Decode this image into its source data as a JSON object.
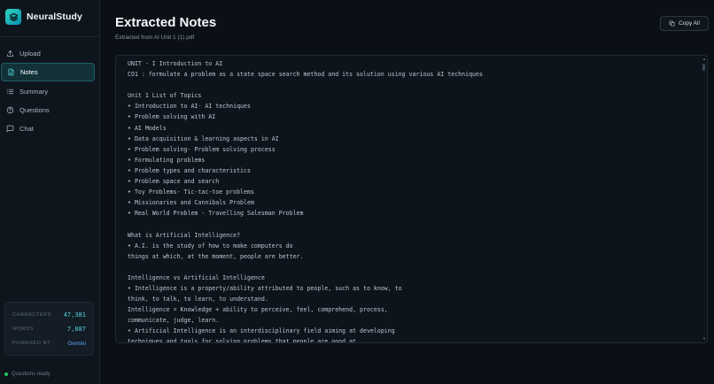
{
  "brand": {
    "name": "NeuralStudy",
    "logo_icon": "layers-icon",
    "accent": "#2dd4bf"
  },
  "nav": [
    {
      "label": "Upload",
      "icon": "upload-icon",
      "active": false
    },
    {
      "label": "Notes",
      "icon": "document-icon",
      "active": true
    },
    {
      "label": "Summary",
      "icon": "list-icon",
      "active": false
    },
    {
      "label": "Questions",
      "icon": "help-circle-icon",
      "active": false
    },
    {
      "label": "Chat",
      "icon": "chat-icon",
      "active": false
    }
  ],
  "stats": {
    "characters_label": "CHARACTERS",
    "characters_value": "47,381",
    "words_label": "WORDS",
    "words_value": "7,887",
    "powered_label": "POWERED BY",
    "powered_value": "Gemini"
  },
  "status": {
    "text": "Questions ready",
    "color": "#22c55e"
  },
  "header": {
    "title": "Extracted Notes",
    "subtitle": "Extracted from AI Unit 1 (1).pdf",
    "copy_label": "Copy All"
  },
  "notes": {
    "lines": [
      "UNIT - I Introduction to AI",
      "CO1 : formulate a problem as a state space search method and its solution using various AI techniques",
      "",
      "Unit 1 List of Topics",
      "• Introduction to AI- AI techniques",
      "• Problem solving with AI",
      "• AI Models",
      "• Data acquisition & learning aspects in AI",
      "• Problem solving- Problem solving process",
      "• Formulating problems",
      "• Problem types and characteristics",
      "• Problem space and search",
      "• Toy Problems- Tic-tac-toe problems",
      "• Missionaries and Cannibals Problem",
      "• Real World Problem - Travelling Salesman Problem",
      "",
      "What is Artificial Intelligence?",
      "• A.I. is the study of how to make computers do",
      "things at which, at the moment, people are better.",
      "",
      "Intelligence vs Artificial Intelligence",
      "• Intelligence is a property/ability attributed to people, such as to know, to",
      "think, to talk, to learn, to understand.",
      "Intelligence = Knowledge + ability to perceive, feel, comprehend, process,",
      "communicate, judge, learn.",
      "• Artificial Intelligence is an interdisciplinary field aiming at developing",
      "techniques and tools for solving problems that people are good at."
    ]
  }
}
